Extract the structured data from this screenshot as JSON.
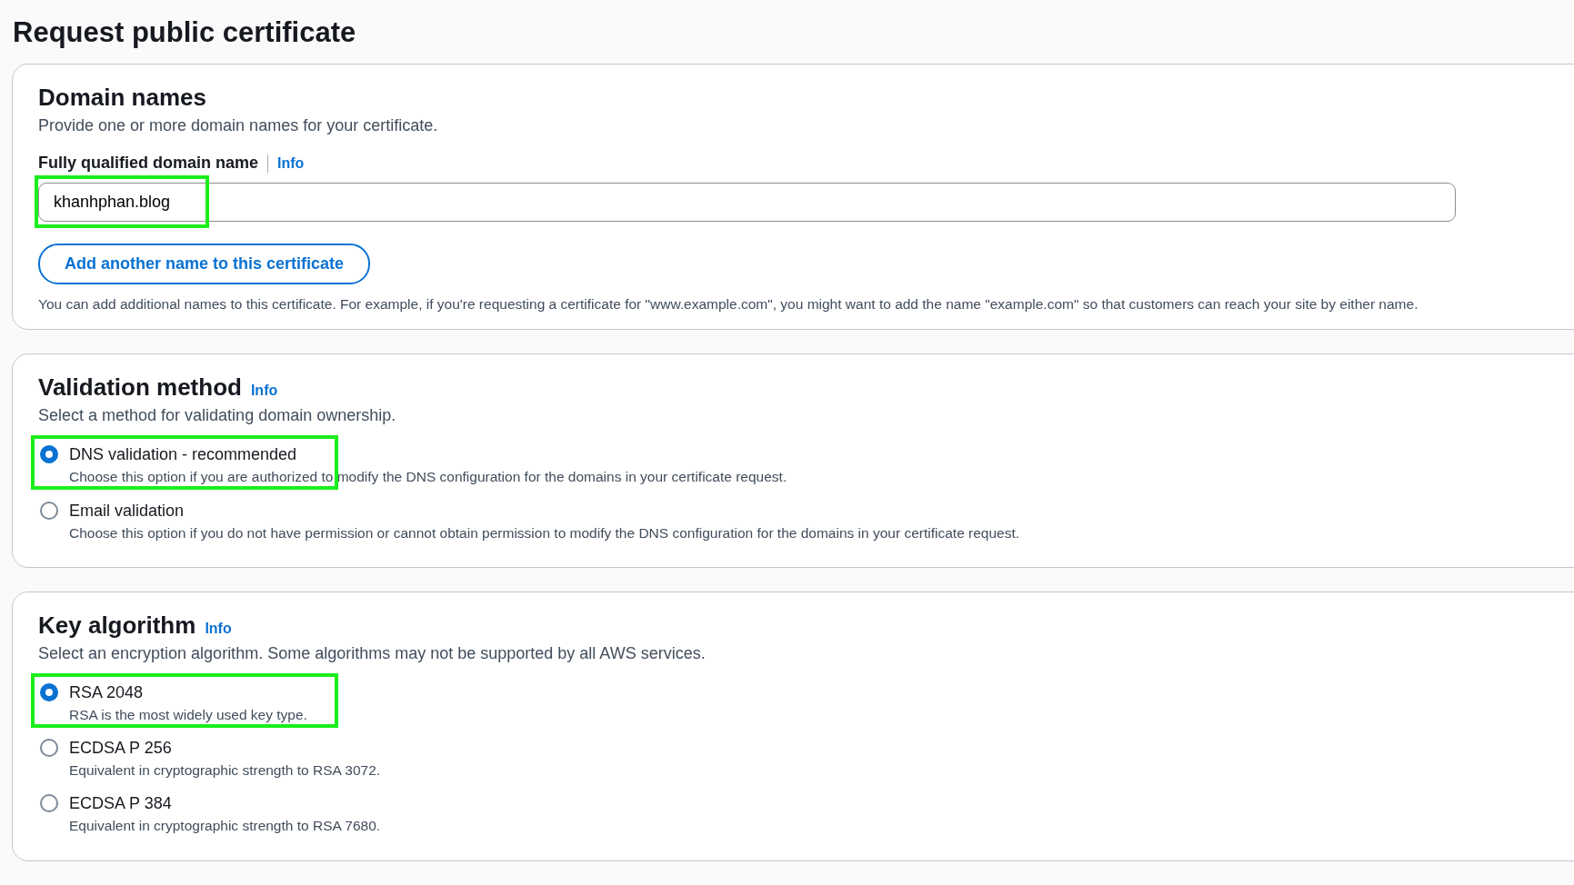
{
  "title": "Request public certificate",
  "domain_names": {
    "heading": "Domain names",
    "description": "Provide one or more domain names for your certificate.",
    "field_label": "Fully qualified domain name",
    "info": "Info",
    "field_value": "khanhphan.blog",
    "highlighted": true,
    "add_button": "Add another name to this certificate",
    "hint": "You can add additional names to this certificate. For example, if you're requesting a certificate for \"www.example.com\", you might want to add the name \"example.com\" so that customers can reach your site by either name."
  },
  "validation_method": {
    "heading": "Validation method",
    "info": "Info",
    "description": "Select a method for validating domain ownership.",
    "options": [
      {
        "label": "DNS validation - recommended",
        "description": "Choose this option if you are authorized to modify the DNS configuration for the domains in your certificate request.",
        "selected": true,
        "highlighted": true
      },
      {
        "label": "Email validation",
        "description": "Choose this option if you do not have permission or cannot obtain permission to modify the DNS configuration for the domains in your certificate request.",
        "selected": false
      }
    ]
  },
  "key_algorithm": {
    "heading": "Key algorithm",
    "info": "Info",
    "description": "Select an encryption algorithm. Some algorithms may not be supported by all AWS services.",
    "options": [
      {
        "label": "RSA 2048",
        "description": "RSA is the most widely used key type.",
        "selected": true,
        "highlighted": true
      },
      {
        "label": "ECDSA P 256",
        "description": "Equivalent in cryptographic strength to RSA 3072.",
        "selected": false
      },
      {
        "label": "ECDSA P 384",
        "description": "Equivalent in cryptographic strength to RSA 7680.",
        "selected": false
      }
    ]
  }
}
